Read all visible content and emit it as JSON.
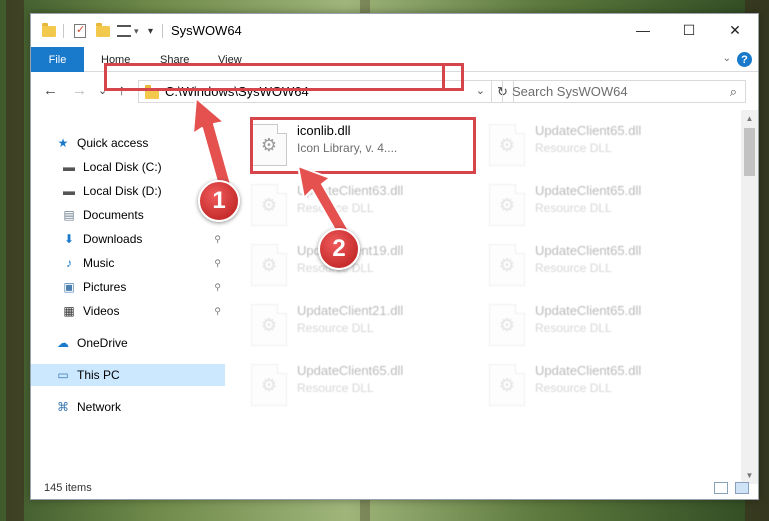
{
  "window": {
    "title": "SysWOW64",
    "minimize_glyph": "—",
    "maximize_glyph": "☐",
    "close_glyph": "✕"
  },
  "ribbon": {
    "tabs": [
      "File",
      "Home",
      "Share",
      "View"
    ]
  },
  "nav": {
    "back_glyph": "←",
    "forward_glyph": "→",
    "recent_glyph": "⌄",
    "up_glyph": "↑",
    "address": "C:\\Windows\\SysWOW64",
    "address_drop_glyph": "⌄",
    "refresh_glyph": "↻",
    "search_placeholder": "Search SysWOW64",
    "search_glyph": "⌕"
  },
  "sidebar": {
    "items": [
      {
        "label": "Quick access",
        "icon": "star-icon",
        "glyph": "★",
        "color": "#1979ca"
      },
      {
        "label": "Local Disk (C:)",
        "icon": "drive-icon",
        "glyph": "▬",
        "color": "#555555"
      },
      {
        "label": "Local Disk (D:)",
        "icon": "drive-icon",
        "glyph": "▬",
        "color": "#555555"
      },
      {
        "label": "Documents",
        "icon": "documents-icon",
        "glyph": "▤",
        "color": "#6b7b8c"
      },
      {
        "label": "Downloads",
        "icon": "download-icon",
        "glyph": "⬇",
        "color": "#1979ca"
      },
      {
        "label": "Music",
        "icon": "music-icon",
        "glyph": "♪",
        "color": "#1979ca"
      },
      {
        "label": "Pictures",
        "icon": "pictures-icon",
        "glyph": "▣",
        "color": "#4a7fb0"
      },
      {
        "label": "Videos",
        "icon": "videos-icon",
        "glyph": "▦",
        "color": "#333333"
      },
      {
        "label": "OneDrive",
        "icon": "cloud-icon",
        "glyph": "☁",
        "color": "#1979ca"
      },
      {
        "label": "This PC",
        "icon": "computer-icon",
        "glyph": "▭",
        "color": "#3a78b5"
      },
      {
        "label": "Network",
        "icon": "network-icon",
        "glyph": "⌘",
        "color": "#3a78b5"
      }
    ],
    "pin_glyph": "📌"
  },
  "files": [
    {
      "name": "iconlib.dll",
      "type": "Icon Library, v. 4....",
      "faded": false
    },
    {
      "name": "UpdateClient63.dll",
      "type": "Resource DLL",
      "faded": true
    },
    {
      "name": "UpdateClient19.dll",
      "type": "Resource DLL",
      "faded": true
    },
    {
      "name": "UpdateClient21.dll",
      "type": "Resource DLL",
      "faded": true
    },
    {
      "name": "UpdateClient65.dll",
      "type": "Resource DLL",
      "faded": true
    },
    {
      "name": "UpdateClient65.dll",
      "type": "Resource DLL",
      "faded": true
    },
    {
      "name": "UpdateClient65.dll",
      "type": "Resource DLL",
      "faded": true
    },
    {
      "name": "UpdateClient65.dll",
      "type": "Resource DLL",
      "faded": true
    },
    {
      "name": "UpdateClient65.dll",
      "type": "Resource DLL",
      "faded": true
    },
    {
      "name": "UpdateClient65.dll",
      "type": "Resource DLL",
      "faded": true
    }
  ],
  "file_icon_glyph": "⚙",
  "status": {
    "item_count": "145 items"
  },
  "callouts": [
    "1",
    "2"
  ],
  "colors": {
    "accent": "#1979ca",
    "highlight": "#d6454c",
    "selection": "#cce8ff"
  }
}
